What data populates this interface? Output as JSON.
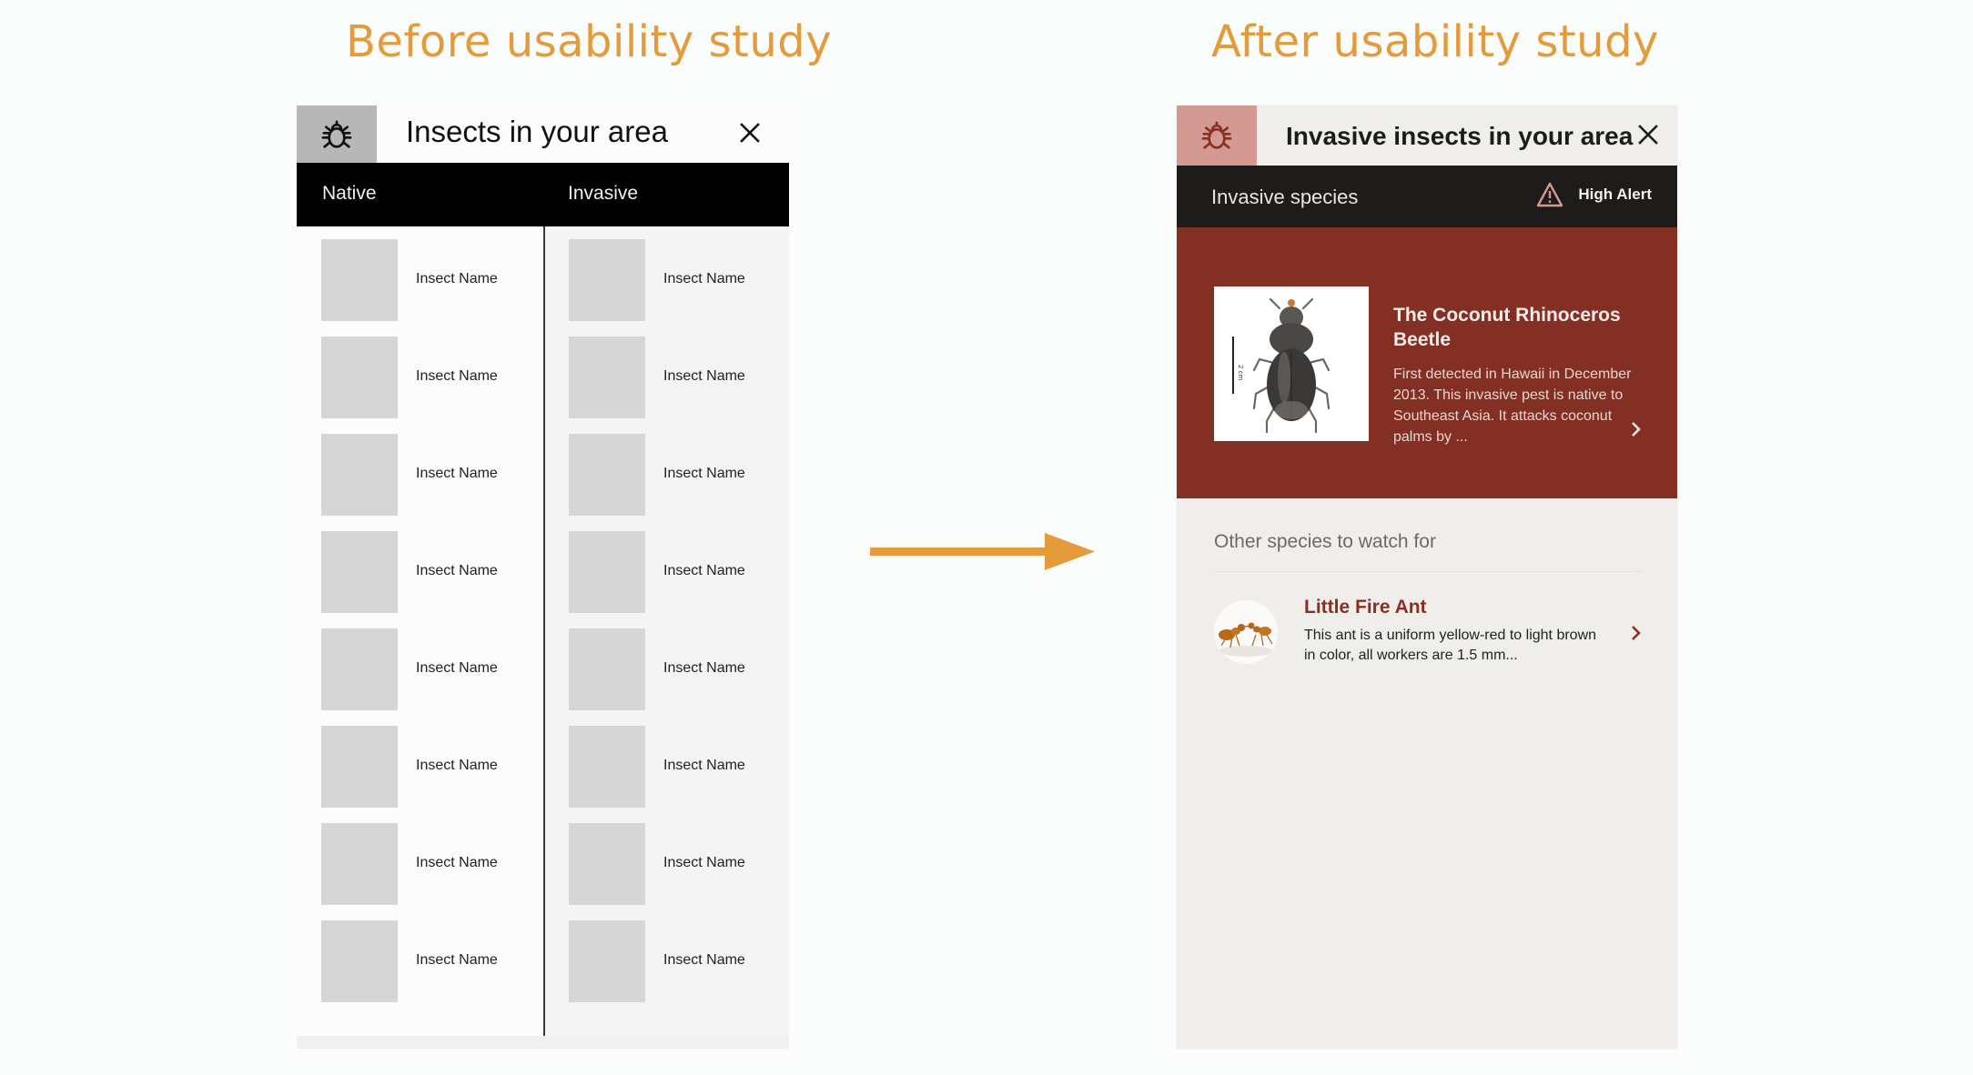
{
  "headings": {
    "before": "Before usability study",
    "after": "After usability study"
  },
  "colors": {
    "heading_accent": "#e39b3c",
    "arrow": "#e39b3c",
    "alert_red": "#832f24",
    "alert_icon_bg": "#d49a92",
    "dark_bar": "#1e1c1b"
  },
  "before_screen": {
    "header": {
      "icon": "bug-icon",
      "title": "Insects in your area",
      "close_icon": "close-icon"
    },
    "tabs": [
      {
        "label": "Native"
      },
      {
        "label": "Invasive"
      }
    ],
    "native_list": [
      {
        "name": "Insect Name"
      },
      {
        "name": "Insect Name"
      },
      {
        "name": "Insect Name"
      },
      {
        "name": "Insect Name"
      },
      {
        "name": "Insect Name"
      },
      {
        "name": "Insect Name"
      },
      {
        "name": "Insect Name"
      },
      {
        "name": "Insect Name"
      }
    ],
    "invasive_list": [
      {
        "name": "Insect Name"
      },
      {
        "name": "Insect Name"
      },
      {
        "name": "Insect Name"
      },
      {
        "name": "Insect Name"
      },
      {
        "name": "Insect Name"
      },
      {
        "name": "Insect Name"
      },
      {
        "name": "Insect Name"
      },
      {
        "name": "Insect Name"
      }
    ]
  },
  "after_screen": {
    "header": {
      "icon": "bug-icon",
      "title": "Invasive insects in your area",
      "close_icon": "close-icon"
    },
    "bar": {
      "label": "Invasive species",
      "alert_icon": "warning-triangle-icon",
      "alert_text": "High Alert"
    },
    "featured": {
      "title": "The Coconut Rhinoceros Beetle",
      "description": "First detected in Hawaii in December 2013. This invasive pest is native to Southeast Asia. It attacks coconut palms by ...",
      "scale_label": "2 cm",
      "chevron_icon": "chevron-right-icon"
    },
    "section_title": "Other species to watch for",
    "others": [
      {
        "title": "Little Fire Ant",
        "description": "This ant is a uniform yellow-red to light brown in color, all workers are 1.5 mm...",
        "chevron_icon": "chevron-right-icon"
      }
    ]
  }
}
